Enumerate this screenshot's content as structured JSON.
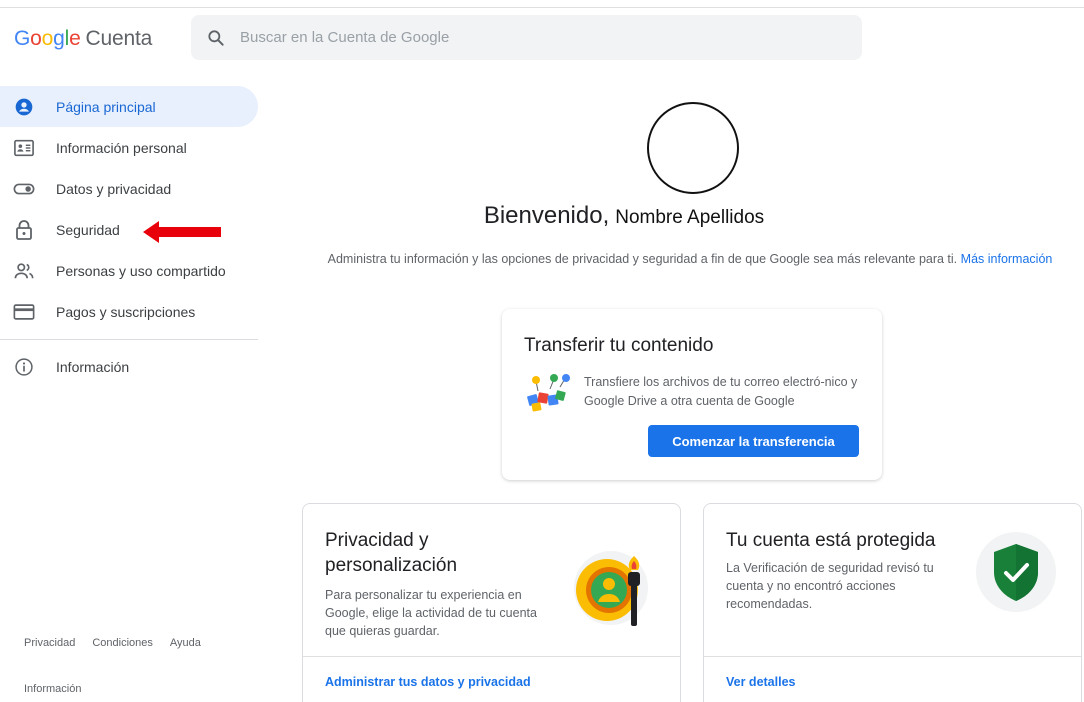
{
  "header": {
    "logo_parts": [
      "G",
      "o",
      "o",
      "g",
      "l",
      "e"
    ],
    "logo_product": "Cuenta",
    "search_placeholder": "Buscar en la Cuenta de Google"
  },
  "sidebar": {
    "items": [
      {
        "label": "Página principal",
        "icon": "home-account-icon",
        "active": true
      },
      {
        "label": "Información personal",
        "icon": "id-card-icon"
      },
      {
        "label": "Datos y privacidad",
        "icon": "toggle-icon"
      },
      {
        "label": "Seguridad",
        "icon": "lock-icon"
      },
      {
        "label": "Personas y uso compartido",
        "icon": "people-icon"
      },
      {
        "label": "Pagos y suscripciones",
        "icon": "credit-card-icon"
      }
    ],
    "info_item": {
      "label": "Información",
      "icon": "info-icon"
    },
    "footer_links": [
      "Privacidad",
      "Condiciones",
      "Ayuda"
    ],
    "footer_info": "Información"
  },
  "main": {
    "welcome_word": "Bienvenido,",
    "user_name": "Nombre Apellidos",
    "description": "Administra tu información y las opciones de privacidad y seguridad a fin de que Google sea más relevante para ti.",
    "more_info_link": "Más información",
    "transfer_card": {
      "title": "Transferir tu contenido",
      "text": "Transfiere los archivos de tu correo electró-nico y Google Drive a otra cuenta de Google",
      "button": "Comenzar la transferencia"
    },
    "privacy_card": {
      "title": "Privacidad y personalización",
      "text": "Para personalizar tu experiencia en Google, elige la actividad de tu cuenta que quieras guardar.",
      "link": "Administrar tus datos y privacidad"
    },
    "security_card": {
      "title": "Tu cuenta está protegida",
      "text": "La Verificación de seguridad revisó tu cuenta y no encontró acciones recomendadas.",
      "link": "Ver detalles"
    }
  },
  "colors": {
    "accent": "#1a73e8",
    "active_nav_bg": "#e8f0fe",
    "annotation_arrow": "#e8000b",
    "shield_green": "#188038"
  }
}
